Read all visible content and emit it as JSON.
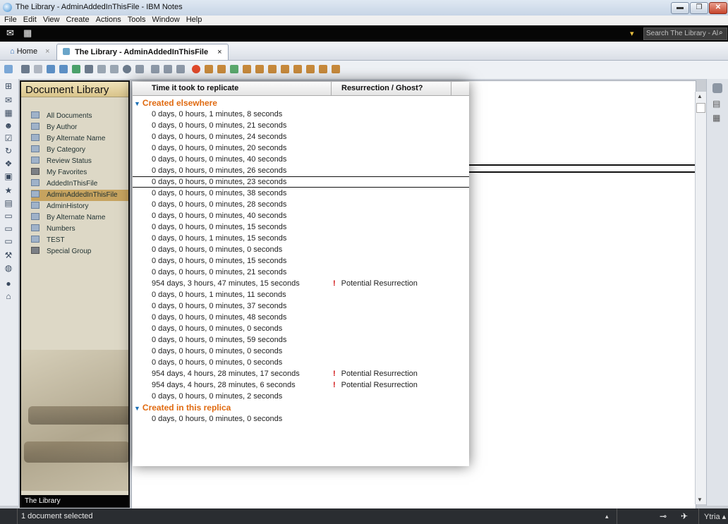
{
  "window": {
    "title": "The Library - AdminAddedInThisFile - IBM Notes"
  },
  "menu": [
    "File",
    "Edit",
    "View",
    "Create",
    "Actions",
    "Tools",
    "Window",
    "Help"
  ],
  "search": {
    "placeholder": "Search The Library - Al"
  },
  "tabs": [
    {
      "label": "Home",
      "close": "×"
    },
    {
      "label": "The Library - AdminAddedInThisFile",
      "close": "×"
    }
  ],
  "nav": {
    "title": "Document Library",
    "items": [
      {
        "label": "All Documents",
        "icon": "view-icon"
      },
      {
        "label": "By Author",
        "icon": "view-icon"
      },
      {
        "label": "By Alternate Name",
        "icon": "view-icon"
      },
      {
        "label": "By Category",
        "icon": "view-icon"
      },
      {
        "label": "Review Status",
        "icon": "view-icon"
      },
      {
        "label": "My Favorites",
        "icon": "folder-icon"
      },
      {
        "label": "AddedInThisFile",
        "icon": "view-icon"
      },
      {
        "label": "AdminAddedInThisFile",
        "icon": "view-icon",
        "selected": true
      },
      {
        "label": "AdminHistory",
        "icon": "view-icon"
      },
      {
        "label": "By Alternate Name",
        "icon": "view-icon"
      },
      {
        "label": "Numbers",
        "icon": "view-icon"
      },
      {
        "label": "TEST",
        "icon": "view-icon"
      },
      {
        "label": "Special Group",
        "icon": "folder-icon"
      }
    ],
    "footer": "The Library"
  },
  "popup": {
    "columns": [
      "Time it took to replicate",
      "Resurrection / Ghost?"
    ],
    "groups": [
      {
        "label": "Created elsewhere",
        "rows": [
          {
            "time": "0 days, 0 hours, 1 minutes, 8 seconds",
            "flag": ""
          },
          {
            "time": "0 days, 0 hours, 0 minutes, 21 seconds",
            "flag": ""
          },
          {
            "time": "0 days, 0 hours, 0 minutes, 24 seconds",
            "flag": ""
          },
          {
            "time": "0 days, 0 hours, 0 minutes, 20 seconds",
            "flag": ""
          },
          {
            "time": "0 days, 0 hours, 0 minutes, 40 seconds",
            "flag": ""
          },
          {
            "time": "0 days, 0 hours, 0 minutes, 26 seconds",
            "flag": ""
          },
          {
            "time": "0 days, 0 hours, 0 minutes, 23 seconds",
            "flag": "",
            "selected": true
          },
          {
            "time": "0 days, 0 hours, 0 minutes, 38 seconds",
            "flag": ""
          },
          {
            "time": "0 days, 0 hours, 0 minutes, 28 seconds",
            "flag": ""
          },
          {
            "time": "0 days, 0 hours, 0 minutes, 40 seconds",
            "flag": ""
          },
          {
            "time": "0 days, 0 hours, 0 minutes, 15 seconds",
            "flag": ""
          },
          {
            "time": "0 days, 0 hours, 1 minutes, 15 seconds",
            "flag": ""
          },
          {
            "time": "0 days, 0 hours, 0 minutes, 0 seconds",
            "flag": ""
          },
          {
            "time": "0 days, 0 hours, 0 minutes, 15 seconds",
            "flag": ""
          },
          {
            "time": "0 days, 0 hours, 0 minutes, 21 seconds",
            "flag": ""
          },
          {
            "time": "954 days, 3 hours, 47 minutes, 15 seconds",
            "flag": "Potential Resurrection"
          },
          {
            "time": "0 days, 0 hours, 1 minutes, 11 seconds",
            "flag": ""
          },
          {
            "time": "0 days, 0 hours, 0 minutes, 37 seconds",
            "flag": ""
          },
          {
            "time": "0 days, 0 hours, 0 minutes, 48 seconds",
            "flag": ""
          },
          {
            "time": "0 days, 0 hours, 0 minutes, 0 seconds",
            "flag": ""
          },
          {
            "time": "0 days, 0 hours, 0 minutes, 59 seconds",
            "flag": ""
          },
          {
            "time": "0 days, 0 hours, 0 minutes, 0 seconds",
            "flag": ""
          },
          {
            "time": "0 days, 0 hours, 0 minutes, 0 seconds",
            "flag": ""
          },
          {
            "time": "954 days, 4 hours, 28 minutes, 17 seconds",
            "flag": "Potential Resurrection"
          },
          {
            "time": "954 days, 4 hours, 28 minutes, 6 seconds",
            "flag": "Potential Resurrection"
          },
          {
            "time": "0 days, 0 hours, 0 minutes, 2 seconds",
            "flag": ""
          }
        ]
      },
      {
        "label": "Created in this replica",
        "rows": [
          {
            "time": "0 days, 0 hours, 0 minutes, 0 seconds",
            "flag": ""
          }
        ]
      }
    ]
  },
  "status": {
    "text": "1 document selected",
    "user": "Ytria"
  }
}
